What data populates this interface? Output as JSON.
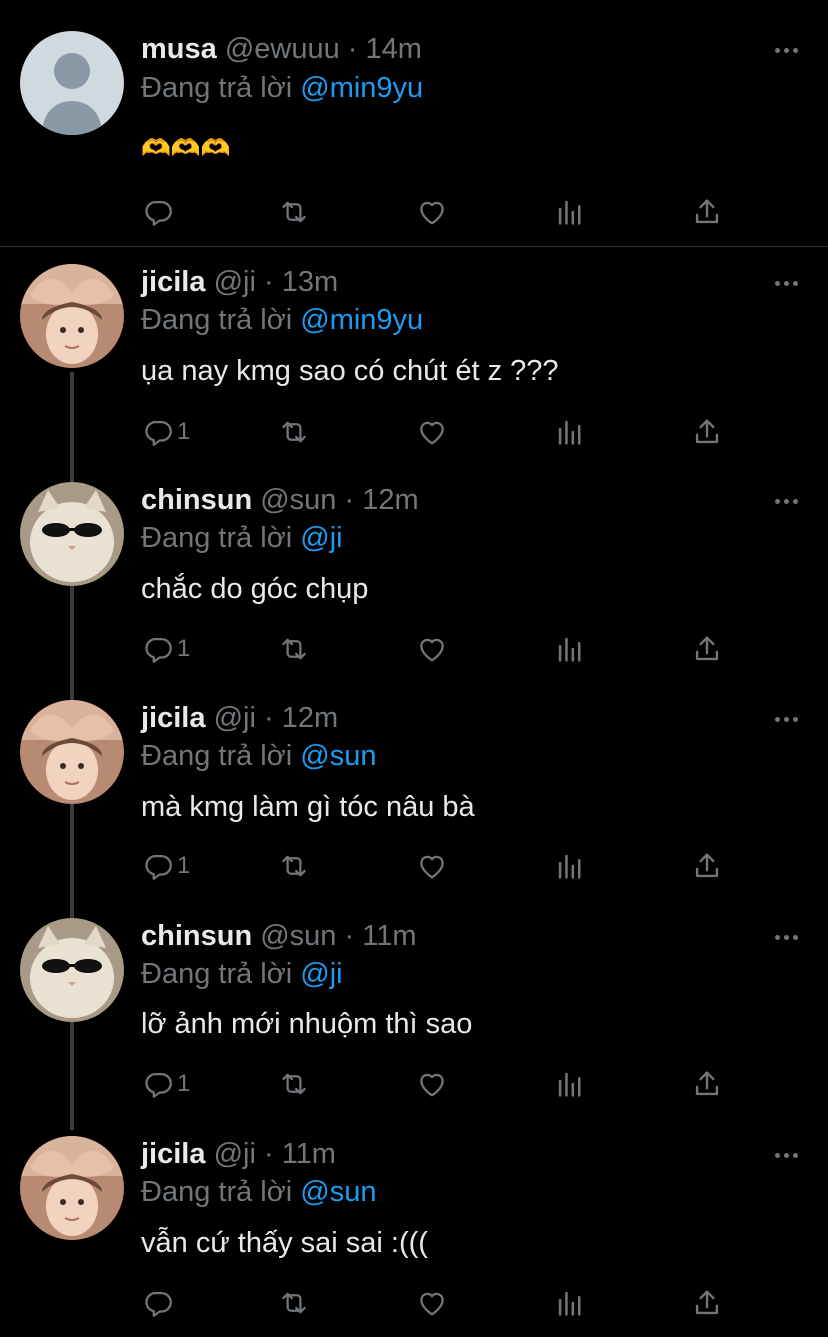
{
  "colors": {
    "background": "#000000",
    "text": "#e7e9ea",
    "muted": "#71767b",
    "mention": "#1d9bf0",
    "divider": "#2f3336"
  },
  "tweets": [
    {
      "name": "musa",
      "handle": "@ewuuu",
      "dot": "·",
      "time": "14m",
      "reply_prefix": "Đang trả lời",
      "reply_to": "@min9yu",
      "text": "🫶🫶🫶",
      "reply_count": "",
      "avatar": "default-avatar-icon"
    },
    {
      "name": "jicila",
      "handle": "@ji",
      "dot": "·",
      "time": "13m",
      "reply_prefix": "Đang trả lời",
      "reply_to": "@min9yu",
      "text": "ụa nay kmg sao có chút ét z ???",
      "reply_count": "1",
      "avatar": "child-heart-hands-photo"
    },
    {
      "name": "chinsun",
      "handle": "@sun",
      "dot": "·",
      "time": "12m",
      "reply_prefix": "Đang trả lời",
      "reply_to": "@ji",
      "text": "chắc do góc chụp",
      "reply_count": "1",
      "avatar": "cat-sunglasses-photo"
    },
    {
      "name": "jicila",
      "handle": "@ji",
      "dot": "·",
      "time": "12m",
      "reply_prefix": "Đang trả lời",
      "reply_to": "@sun",
      "text": "mà kmg làm gì tóc nâu bà",
      "reply_count": "1",
      "avatar": "child-heart-hands-photo"
    },
    {
      "name": "chinsun",
      "handle": "@sun",
      "dot": "·",
      "time": "11m",
      "reply_prefix": "Đang trả lời",
      "reply_to": "@ji",
      "text": "lỡ ảnh mới nhuộm thì sao",
      "reply_count": "1",
      "avatar": "cat-sunglasses-photo"
    },
    {
      "name": "jicila",
      "handle": "@ji",
      "dot": "·",
      "time": "11m",
      "reply_prefix": "Đang trả lời",
      "reply_to": "@sun",
      "text": "vẫn cứ thấy sai sai :(((",
      "reply_count": "",
      "avatar": "child-heart-hands-photo"
    }
  ],
  "action_icons": [
    "reply-icon",
    "retweet-icon",
    "like-icon",
    "views-icon",
    "share-icon"
  ]
}
